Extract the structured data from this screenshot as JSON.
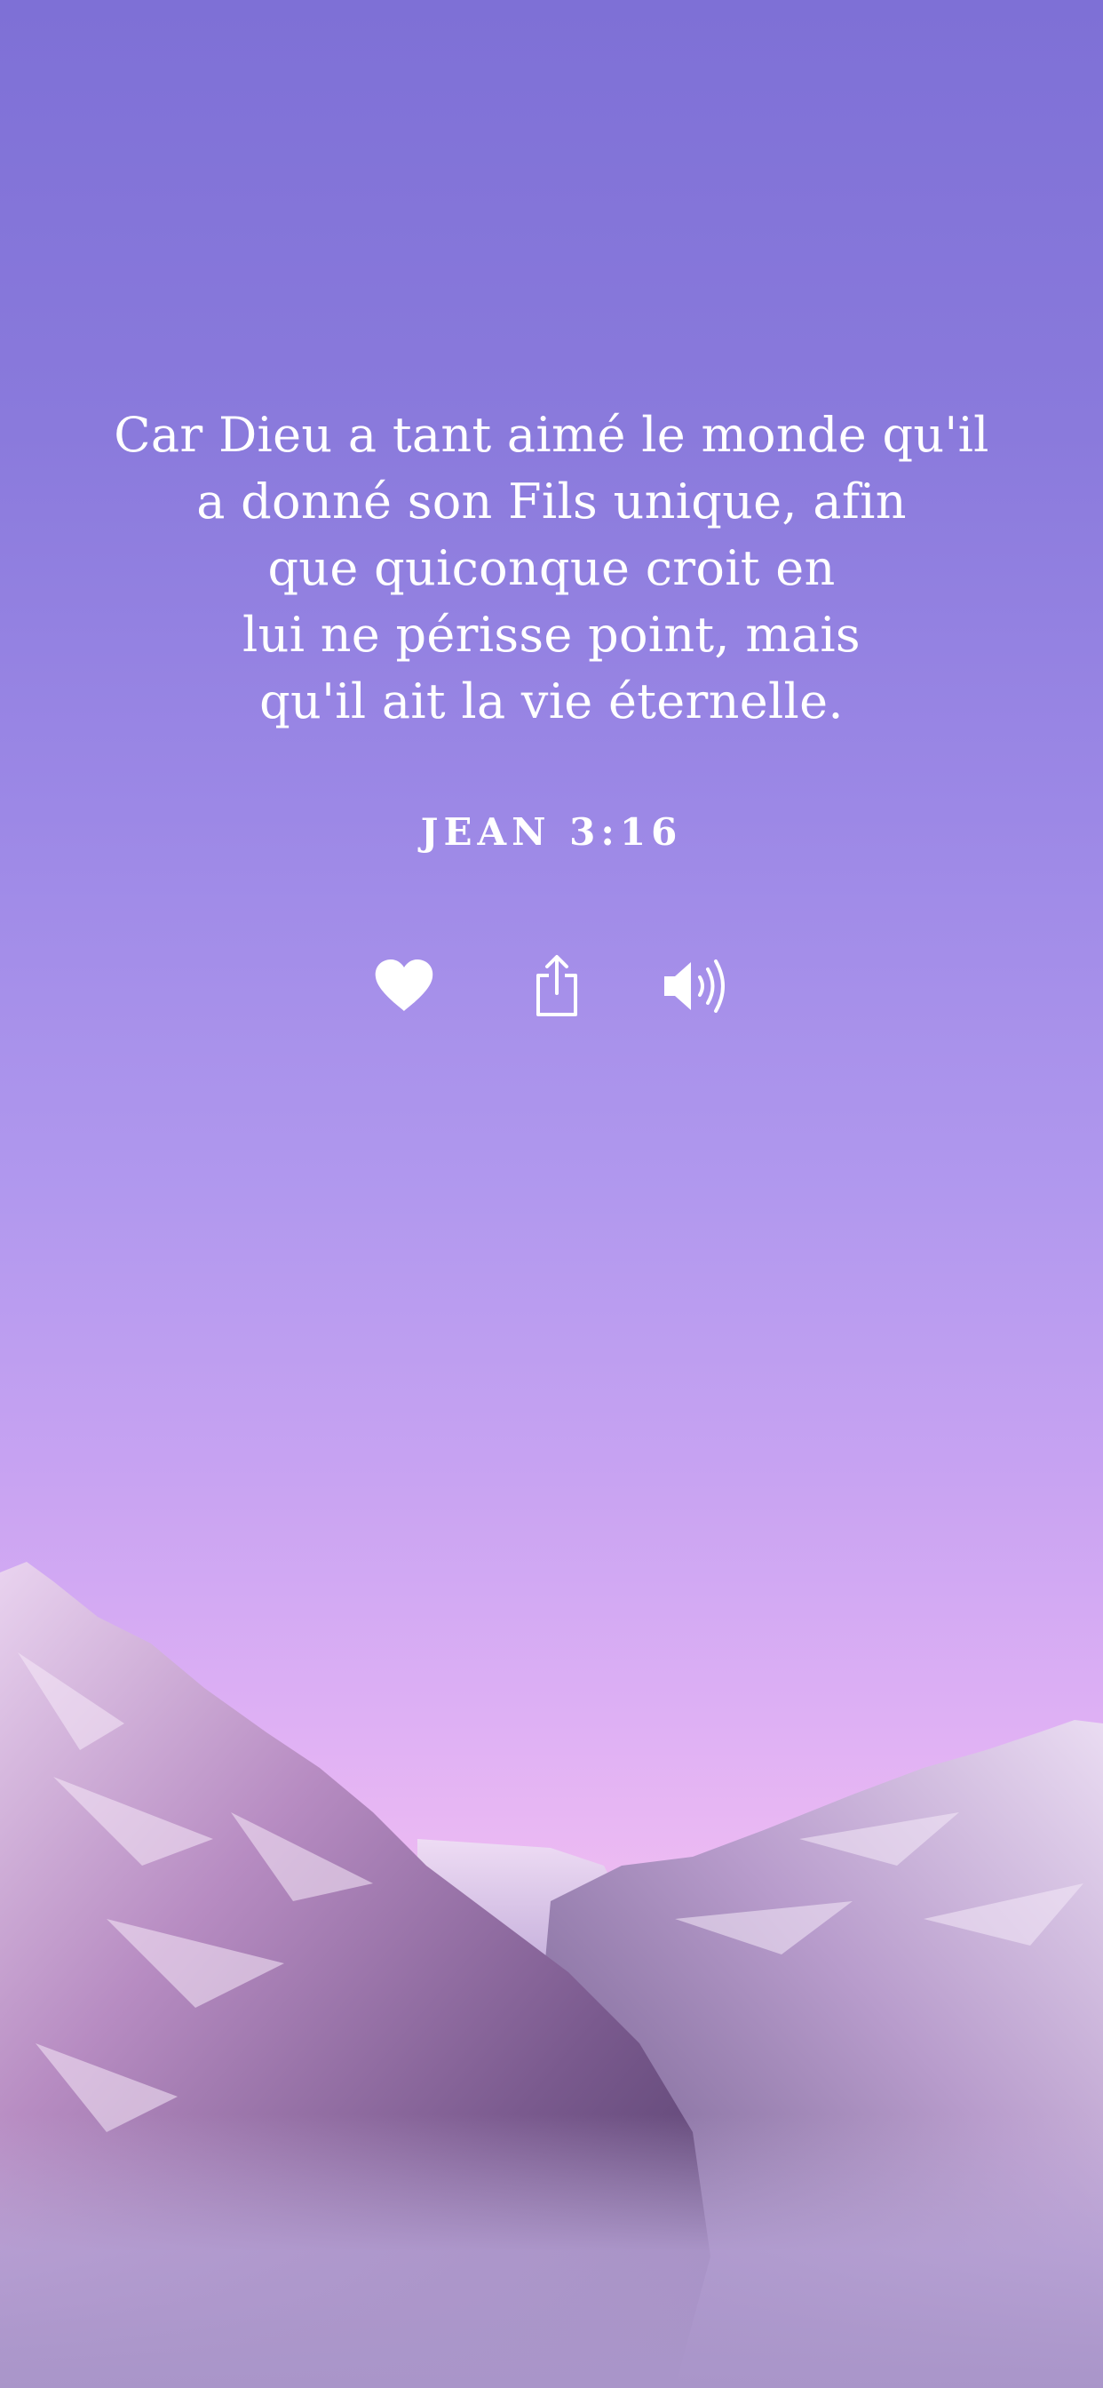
{
  "verse": {
    "lines": [
      "Car Dieu a tant aimé le monde qu'il",
      "a donné son Fils unique, afin",
      "que quiconque croit en",
      "lui ne périsse point, mais",
      "qu'il ait la vie éternelle."
    ],
    "reference": "JEAN 3:16"
  },
  "actions": [
    {
      "name": "like",
      "icon": "heart-icon"
    },
    {
      "name": "share",
      "icon": "share-icon"
    },
    {
      "name": "listen",
      "icon": "speaker-icon"
    }
  ],
  "background": {
    "sky_top_color": "#7e70d6",
    "sky_bottom_color": "#f6c8f0",
    "scene": "snowy mountains"
  }
}
